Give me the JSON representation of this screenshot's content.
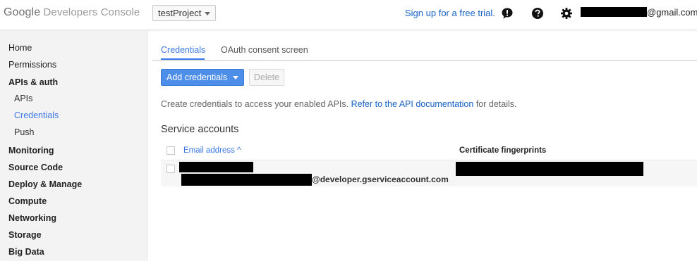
{
  "topbar": {
    "logo_google": "Google",
    "logo_product": "Developers Console",
    "project": "testProject",
    "signup_link": "Sign up for a free trial.",
    "icons": [
      "feedback-icon",
      "help-icon",
      "settings-gear-icon"
    ],
    "account_suffix": "@gmail.com"
  },
  "sidebar": {
    "items": [
      {
        "label": "Home"
      },
      {
        "label": "Permissions"
      },
      {
        "label": "APIs & auth"
      },
      {
        "label": "APIs"
      },
      {
        "label": "Credentials"
      },
      {
        "label": "Push"
      },
      {
        "label": "Monitoring"
      },
      {
        "label": "Source Code"
      },
      {
        "label": "Deploy & Manage"
      },
      {
        "label": "Compute"
      },
      {
        "label": "Networking"
      },
      {
        "label": "Storage"
      },
      {
        "label": "Big Data"
      }
    ]
  },
  "main": {
    "tabs": [
      {
        "label": "Credentials"
      },
      {
        "label": "OAuth consent screen"
      }
    ],
    "add_button": "Add credentials",
    "delete_button": "Delete",
    "desc_text": "Create credentials to access your enabled APIs.",
    "desc_link": "Refer to the API documentation",
    "desc_suffix": "for details.",
    "section_title": "Service accounts",
    "table": {
      "col_email": "Email address",
      "sort_indicator": "^",
      "col_fingerprints": "Certificate fingerprints",
      "row_domain": "@developer.gserviceaccount.com"
    }
  },
  "colors": {
    "accent": "#3b78e7",
    "link": "#1a63c6",
    "primary_button": "#4d8ee8",
    "sidebar_bg": "#f3f3f3"
  }
}
